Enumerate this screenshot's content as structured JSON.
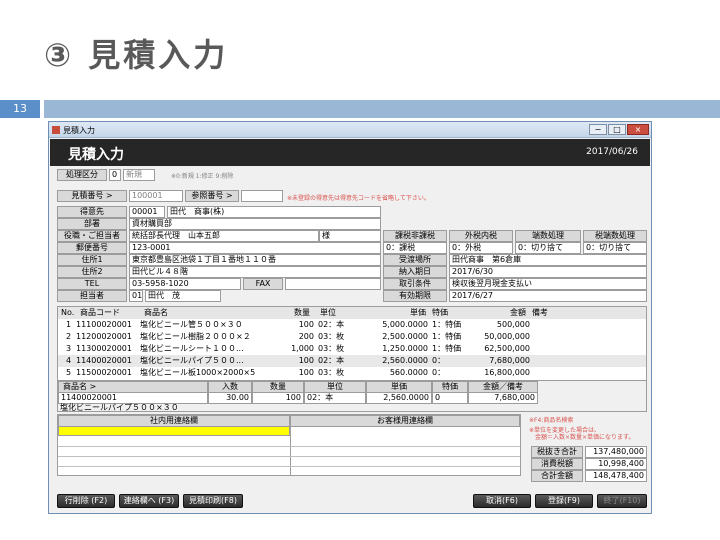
{
  "slide": {
    "title": "③ 見積入力",
    "number": "13"
  },
  "window": {
    "title": "見積入力",
    "controls": [
      "−",
      "□",
      "×"
    ],
    "header_title": "見積入力",
    "header_date": "2017/06/26"
  },
  "process": {
    "label": "処理区分",
    "code": "0",
    "value": "新規",
    "hint": "※0:新規 1:修正 9:削除"
  },
  "estimate_no": {
    "label": "見積番号 >",
    "value": "100001"
  },
  "ref_no": {
    "label": "参照番号 >",
    "value": "",
    "hint": "※未登録の得意先は得意先コードを省略して下さい。"
  },
  "customer": {
    "label": "得意先",
    "code": "00001",
    "name": "田代　商事(株)",
    "dept_label": "部署",
    "dept": "資材購買部",
    "contact_label": "役職・ご担当者",
    "contact": "統括部長代理　山本五郎",
    "honorific": "様",
    "zip_label": "郵便番号",
    "zip": "123-0001",
    "addr1_label": "住所1",
    "addr1": "東京都豊島区池袋１丁目１番地１１０番",
    "addr2_label": "住所2",
    "addr2": "田代ビル４８階",
    "tel_label": "TEL",
    "tel": "03-5958-1020",
    "fax_label": "FAX",
    "fax": "",
    "staff_label": "担当者",
    "staff_code": "01",
    "staff_name": "田代　茂"
  },
  "tax": {
    "h1": "課税非課税",
    "h2": "外税内税",
    "h3": "端数処理",
    "h4": "税端数処理",
    "v1": "0：課税",
    "v2": "0：外税",
    "v3": "0：切り捨て",
    "v4": "0：切り捨て"
  },
  "delivery": {
    "place_label": "受渡場所",
    "place": "田代商事　第6倉庫",
    "date_label": "納入期日",
    "date": "2017/6/30",
    "terms_label": "取引条件",
    "terms": "検収後翌月現金支払い",
    "expiry_label": "有効期限",
    "expiry": "2017/6/27"
  },
  "items_table": {
    "headers": [
      "No.",
      "商品コード",
      "商品名",
      "数量",
      "単位",
      "単価",
      "特価",
      "金額",
      "備考"
    ],
    "rows": [
      [
        "1",
        "11100020001",
        "塩化ビニール管５００×３０",
        "100",
        "02：本",
        "5,000.0000",
        "1：特価",
        "500,000",
        ""
      ],
      [
        "2",
        "11200020001",
        "塩化ビニール樹脂２０００×２",
        "200",
        "03：枚",
        "2,500.0000",
        "1：特価",
        "50,000,000",
        ""
      ],
      [
        "3",
        "11300020001",
        "塩化ビニールシート１００...",
        "1,000",
        "03：枚",
        "1,250.0000",
        "1：特価",
        "62,500,000",
        ""
      ],
      [
        "4",
        "11400020001",
        "塩化ビニールパイプ５００...",
        "100",
        "02：本",
        "2,560.0000",
        "0：",
        "7,680,000",
        ""
      ],
      [
        "5",
        "11500020001",
        "塩化ビニール板1000×2000×5",
        "100",
        "03：枚",
        "560.0000",
        "0：",
        "16,800,000",
        ""
      ]
    ]
  },
  "edit": {
    "h_name": "商品名 >",
    "h_qty_in": "入数",
    "h_qty": "数量",
    "h_unit": "単位",
    "h_price": "単価",
    "h_special": "特価",
    "h_amount": "金額／備考",
    "code": "11400020001",
    "qty_in": "30.00",
    "qty": "100",
    "unit": "02：本",
    "price": "2,560.0000",
    "special": "0",
    "amount": "7,680,000",
    "name": "塩化ビニールパイプ５００×３０"
  },
  "memo": {
    "internal": "社内用連絡欄",
    "customer": "お客様用連絡欄"
  },
  "notes": {
    "n1": "※F4:商品名検索",
    "n2": "※単位を変更した場合は、",
    "n3": "　金額＝入数×数量×単価になります。"
  },
  "totals": {
    "sub_label": "税抜き合計",
    "sub": "137,480,000",
    "tax_label": "消費税額",
    "tax": "10,998,400",
    "total_label": "合計金額",
    "total": "148,478,400"
  },
  "buttons": {
    "delete_row": "行削除 (F2)",
    "memo_to": "連絡欄へ (F3)",
    "print": "見積印刷(F8)",
    "cancel": "取消(F6)",
    "register": "登録(F9)",
    "close": "終了(F10)"
  },
  "colors": {
    "header_bg": "#262626",
    "memo_highlight": "#ffff00",
    "slide_bar": "#9bb7d6"
  }
}
